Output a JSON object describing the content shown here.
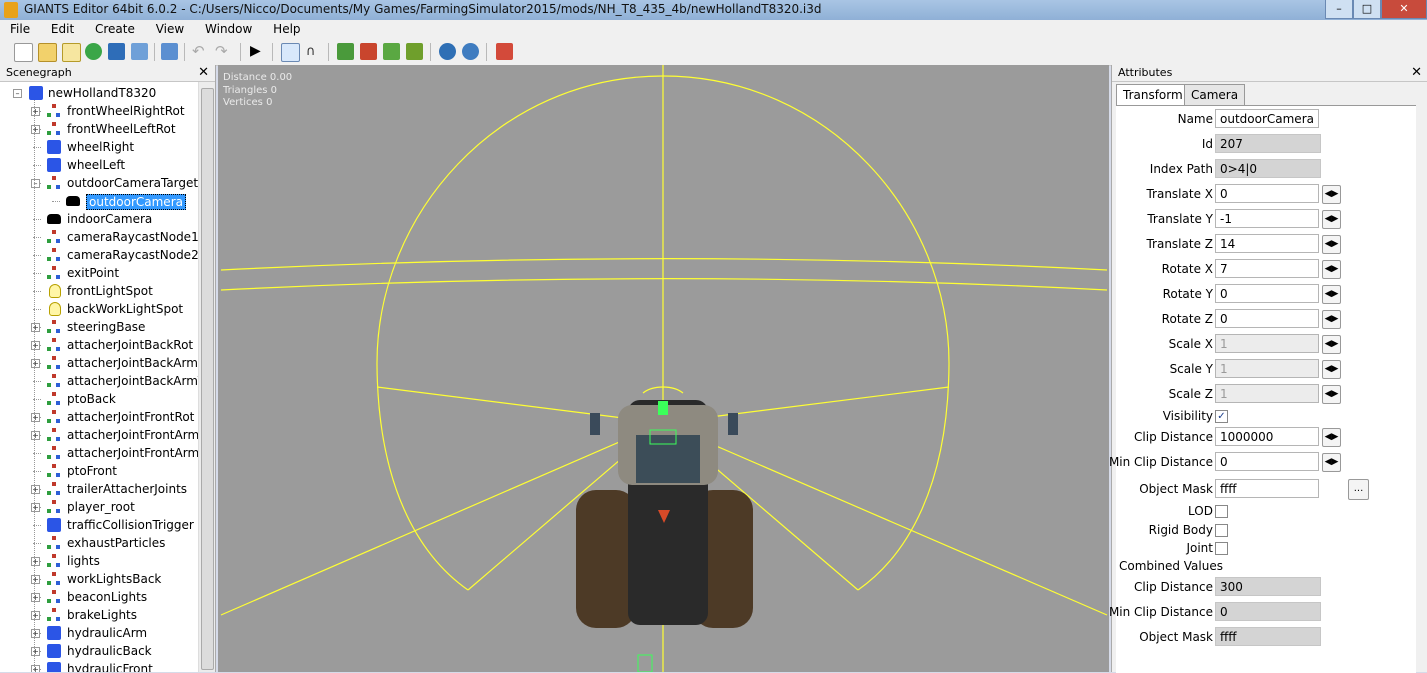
{
  "window": {
    "title": "GIANTS Editor 64bit 6.0.2 - C:/Users/Nicco/Documents/My Games/FarmingSimulator2015/mods/NH_T8_435_4b/newHollandT8320.i3d",
    "buttons": [
      "minimize",
      "maximize",
      "close"
    ]
  },
  "menu": [
    "File",
    "Edit",
    "Create",
    "View",
    "Window",
    "Help"
  ],
  "toolbar": {
    "icons": [
      "new-icon",
      "open-icon",
      "edit-icon",
      "refresh-icon",
      "save-icon",
      "import-icon",
      "export-icon",
      "undo-icon",
      "redo-icon",
      "play-icon",
      "select-icon",
      "move-icon",
      "terrain-icon",
      "paint-icon",
      "foliage-icon",
      "tree-icon",
      "plugin-icon",
      "settings-icon",
      "exit-icon"
    ]
  },
  "scenegraph": {
    "header": "Scenegraph",
    "close": "✕",
    "root": "newHollandT8320",
    "items": [
      {
        "label": "frontWheelRightRot",
        "icon": "transformgroup",
        "expand": true,
        "depth": 1
      },
      {
        "label": "frontWheelLeftRot",
        "icon": "transformgroup",
        "expand": true,
        "depth": 1
      },
      {
        "label": "wheelRight",
        "icon": "shape",
        "expand": false,
        "depth": 1
      },
      {
        "label": "wheelLeft",
        "icon": "shape",
        "expand": false,
        "depth": 1
      },
      {
        "label": "outdoorCameraTarget",
        "icon": "transformgroup",
        "expand": true,
        "expanded": true,
        "depth": 1
      },
      {
        "label": "outdoorCamera",
        "icon": "camera",
        "expand": false,
        "depth": 2,
        "selected": true
      },
      {
        "label": "indoorCamera",
        "icon": "camera",
        "expand": false,
        "depth": 1
      },
      {
        "label": "cameraRaycastNode1",
        "icon": "transformgroup",
        "expand": false,
        "depth": 1
      },
      {
        "label": "cameraRaycastNode2",
        "icon": "transformgroup",
        "expand": false,
        "depth": 1
      },
      {
        "label": "exitPoint",
        "icon": "transformgroup",
        "expand": false,
        "depth": 1
      },
      {
        "label": "frontLightSpot",
        "icon": "light",
        "expand": false,
        "depth": 1
      },
      {
        "label": "backWorkLightSpot",
        "icon": "light",
        "expand": false,
        "depth": 1
      },
      {
        "label": "steeringBase",
        "icon": "transformgroup",
        "expand": true,
        "depth": 1
      },
      {
        "label": "attacherJointBackRot",
        "icon": "transformgroup",
        "expand": true,
        "depth": 1
      },
      {
        "label": "attacherJointBackArmBc",
        "icon": "transformgroup",
        "expand": true,
        "depth": 1
      },
      {
        "label": "attacherJointBackArmTo",
        "icon": "transformgroup",
        "expand": false,
        "depth": 1
      },
      {
        "label": "ptoBack",
        "icon": "transformgroup",
        "expand": false,
        "depth": 1
      },
      {
        "label": "attacherJointFrontRot",
        "icon": "transformgroup",
        "expand": true,
        "depth": 1
      },
      {
        "label": "attacherJointFrontArmBc",
        "icon": "transformgroup",
        "expand": true,
        "depth": 1
      },
      {
        "label": "attacherJointFrontArmTo",
        "icon": "transformgroup",
        "expand": false,
        "depth": 1
      },
      {
        "label": "ptoFront",
        "icon": "transformgroup",
        "expand": false,
        "depth": 1
      },
      {
        "label": "trailerAttacherJoints",
        "icon": "transformgroup",
        "expand": true,
        "depth": 1
      },
      {
        "label": "player_root",
        "icon": "transformgroup",
        "expand": true,
        "depth": 1
      },
      {
        "label": "trafficCollisionTrigger",
        "icon": "shape",
        "expand": false,
        "depth": 1
      },
      {
        "label": "exhaustParticles",
        "icon": "transformgroup",
        "expand": false,
        "depth": 1
      },
      {
        "label": "lights",
        "icon": "transformgroup",
        "expand": true,
        "depth": 1
      },
      {
        "label": "workLightsBack",
        "icon": "transformgroup",
        "expand": true,
        "depth": 1
      },
      {
        "label": "beaconLights",
        "icon": "transformgroup",
        "expand": true,
        "depth": 1
      },
      {
        "label": "brakeLights",
        "icon": "transformgroup",
        "expand": true,
        "depth": 1
      },
      {
        "label": "hydraulicArm",
        "icon": "shape",
        "expand": true,
        "depth": 1
      },
      {
        "label": "hydraulicBack",
        "icon": "shape",
        "expand": true,
        "depth": 1
      },
      {
        "label": "hydraulicFront",
        "icon": "shape",
        "expand": true,
        "depth": 1
      }
    ]
  },
  "viewport": {
    "stats": [
      "Distance 0.00",
      "Triangles 0",
      "Vertices 0"
    ],
    "gizmo_color": "#ffff33",
    "background": "#9b9b9b"
  },
  "attributes": {
    "header": "Attributes",
    "close": "✕",
    "tabs": [
      "Transform",
      "Camera"
    ],
    "active_tab": "Transform",
    "fields": {
      "name": {
        "label": "Name",
        "value": "outdoorCamera"
      },
      "id": {
        "label": "Id",
        "value": "207"
      },
      "index_path": {
        "label": "Index Path",
        "value": "0>4|0"
      },
      "tx": {
        "label": "Translate X",
        "value": "0"
      },
      "ty": {
        "label": "Translate Y",
        "value": "-1"
      },
      "tz": {
        "label": "Translate Z",
        "value": "14"
      },
      "rx": {
        "label": "Rotate X",
        "value": "7"
      },
      "ry": {
        "label": "Rotate Y",
        "value": "0"
      },
      "rz": {
        "label": "Rotate Z",
        "value": "0"
      },
      "sx": {
        "label": "Scale X",
        "value": "1"
      },
      "sy": {
        "label": "Scale Y",
        "value": "1"
      },
      "sz": {
        "label": "Scale Z",
        "value": "1"
      },
      "visibility": {
        "label": "Visibility",
        "checked": true
      },
      "clip": {
        "label": "Clip Distance",
        "value": "1000000"
      },
      "minclip": {
        "label": "Min Clip Distance",
        "value": "0"
      },
      "mask": {
        "label": "Object Mask",
        "value": "ffff",
        "button": "..."
      },
      "lod": {
        "label": "LOD",
        "checked": false
      },
      "rigid": {
        "label": "Rigid Body",
        "checked": false
      },
      "joint": {
        "label": "Joint",
        "checked": false
      },
      "combined_header": "Combined Values",
      "c_clip": {
        "label": "Clip Distance",
        "value": "300"
      },
      "c_minclip": {
        "label": "Min Clip Distance",
        "value": "0"
      },
      "c_mask": {
        "label": "Object Mask",
        "value": "ffff"
      }
    }
  }
}
